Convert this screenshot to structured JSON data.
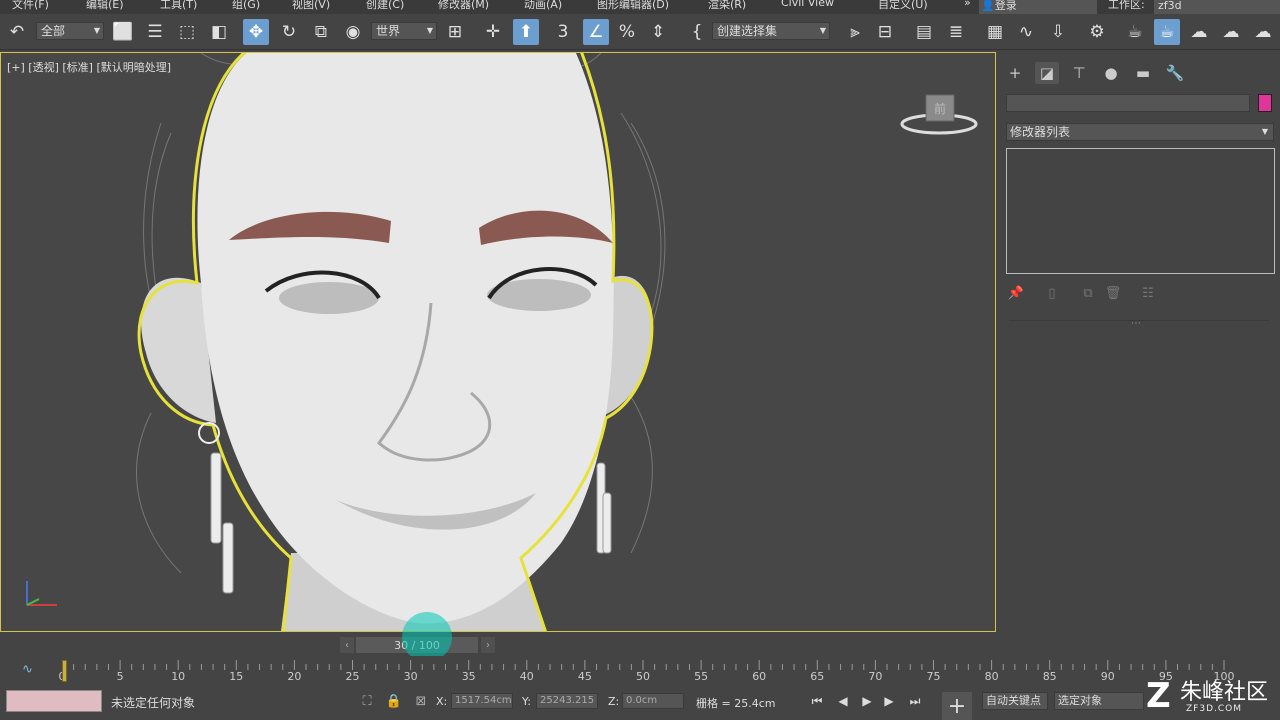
{
  "menu": {
    "items": [
      "文件(F)",
      "编辑(E)",
      "工具(T)",
      "组(G)",
      "视图(V)",
      "创建(C)",
      "修改器(M)",
      "动画(A)",
      "图形编辑器(D)",
      "渲染(R)",
      "Civil View",
      "自定义(U)"
    ],
    "overflow": "»",
    "login": "登录",
    "workspace_label": "工作区:",
    "workspace_value": "zf3d"
  },
  "toolbar": {
    "selection_filter": "全部",
    "reference_coord": "世界",
    "named_selection": "创建选择集",
    "snap_label": "3"
  },
  "viewport": {
    "label": "[+] [透视] [标准] [默认明暗处理]",
    "viewcube_label": "前"
  },
  "command_panel": {
    "modifier_list": "修改器列表",
    "color_swatch": "#e0359a"
  },
  "time_slider": {
    "label": "30 / 100",
    "current_frame": 30,
    "total_frames": 100
  },
  "trackbar": {
    "ticks": [
      "0",
      "5",
      "10",
      "15",
      "20",
      "25",
      "30",
      "35",
      "40",
      "45",
      "50",
      "55",
      "60",
      "65",
      "70",
      "75",
      "80",
      "85",
      "90",
      "95",
      "100"
    ]
  },
  "status": {
    "message": "未选定任何对象",
    "x_label": "X:",
    "x_value": "1517.54cm",
    "y_label": "Y:",
    "y_value": "25243.215",
    "z_label": "Z:",
    "z_value": "0.0cm",
    "grid": "栅格 = 25.4cm",
    "auto_key": "自动关键点",
    "selected_object": "选定对象"
  },
  "watermark": {
    "main": "朱峰社区",
    "sub": "ZF3D.COM"
  },
  "colors": {
    "accent": "#6c9fcf",
    "selection_outline": "#e6e23a",
    "eyebrow": "#8a5a52",
    "cursor_highlight": "#00c8b4"
  }
}
